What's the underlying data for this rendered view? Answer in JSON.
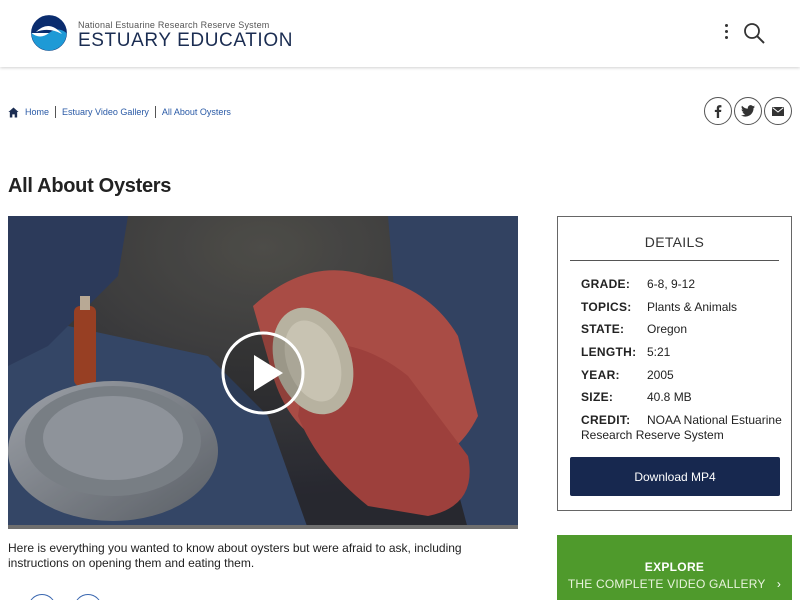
{
  "header": {
    "agency": "National Estuarine Research Reserve System",
    "site_title": "ESTUARY EDUCATION",
    "icons": [
      "noaa-logo",
      "kebab-menu-icon",
      "search-icon"
    ]
  },
  "breadcrumb": {
    "items": [
      "Home",
      "Estuary Video Gallery",
      "All About Oysters"
    ],
    "icon": "home-icon"
  },
  "share": {
    "icons": [
      "facebook-icon",
      "twitter-icon",
      "email-icon"
    ]
  },
  "page": {
    "title": "All About Oysters",
    "description": "Here is everything you wanted to know about oysters but were afraid to ask, including instructions on opening them and eating them."
  },
  "details": {
    "heading": "DETAILS",
    "rows": [
      {
        "key": "GRADE:",
        "value": "6-8, 9-12"
      },
      {
        "key": "TOPICS:",
        "value": "Plants & Animals"
      },
      {
        "key": "STATE:",
        "value": "Oregon"
      },
      {
        "key": "LENGTH:",
        "value": "5:21"
      },
      {
        "key": "YEAR:",
        "value": "2005"
      },
      {
        "key": "SIZE:",
        "value": "40.8 MB"
      },
      {
        "key": "CREDIT:",
        "value": "NOAA National Estuarine Research Reserve System"
      }
    ],
    "download_label": "Download MP4"
  },
  "explore": {
    "title": "EXPLORE",
    "subtitle": "THE COMPLETE VIDEO GALLERY"
  },
  "colors": {
    "brand_navy": "#1b2d52",
    "download_button": "#17284f",
    "explore_green": "#4f9a2c",
    "link_blue": "#2a5aa6"
  }
}
